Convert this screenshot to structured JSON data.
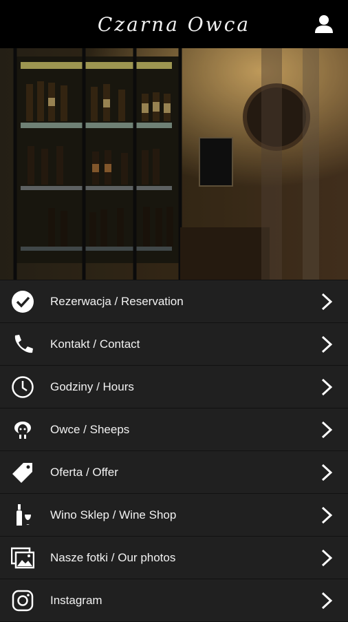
{
  "header": {
    "logo_text": "Czarna Owca",
    "profile_icon": "user-icon"
  },
  "hero": {
    "image": "wine-bar-interior-photo"
  },
  "menu": {
    "items": [
      {
        "label": "Rezerwacja / Reservation",
        "icon": "checkmark-circle-icon"
      },
      {
        "label": "Kontakt / Contact",
        "icon": "phone-icon"
      },
      {
        "label": "Godziny / Hours",
        "icon": "clock-icon"
      },
      {
        "label": "Owce / Sheeps",
        "icon": "sheep-icon"
      },
      {
        "label": "Oferta / Offer",
        "icon": "price-tag-icon"
      },
      {
        "label": "Wino Sklep / Wine Shop",
        "icon": "wine-bottle-glass-icon"
      },
      {
        "label": "Nasze fotki / Our photos",
        "icon": "photos-icon"
      },
      {
        "label": "Instagram",
        "icon": "instagram-icon"
      }
    ]
  },
  "colors": {
    "header_bg": "#000000",
    "menu_bg": "#202020",
    "text": "#f2f2f2"
  }
}
